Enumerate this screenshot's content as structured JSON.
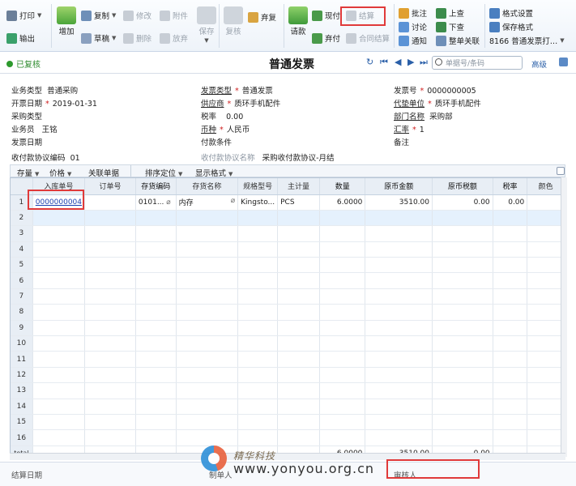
{
  "toolbar": {
    "print": "打印",
    "export": "输出",
    "add": "增加",
    "copy": "复制",
    "modify": "修改",
    "attach": "附件",
    "draft": "草稿",
    "delete": "删除",
    "abandon": "放弃",
    "save": "保存",
    "verify": "复核",
    "reprice": "弃复",
    "request_pay": "请款",
    "cash_pay": "现付",
    "settle": "结算",
    "pay": "弃付",
    "contract_settle": "合同结算",
    "annotate": "批注",
    "discuss": "讨论",
    "notify": "通知",
    "prev_page": "上查",
    "next_page": "下查",
    "full_link": "整单关联",
    "format_settings": "格式设置",
    "save_format": "保存格式",
    "template_select": "8166 普通发票打…"
  },
  "titlebar": {
    "status": "已复核",
    "title": "普通发票",
    "search_placeholder": "单据号/条码",
    "advanced": "高级"
  },
  "form": {
    "biz_type_label": "业务类型",
    "biz_type": "普通采购",
    "inv_type_label": "发票类型",
    "inv_type": "普通发票",
    "inv_no_label": "发票号",
    "inv_no": "0000000005",
    "bill_date_label": "开票日期",
    "bill_date": "2019-01-31",
    "supplier_label": "供应商",
    "supplier": "质环手机配件",
    "payee_label": "代垫单位",
    "payee": "质环手机配件",
    "purch_type_label": "采购类型",
    "purch_type": "",
    "tax_rate_label": "税率",
    "tax_rate": "0.00",
    "dept_label": "部门名称",
    "dept": "采购部",
    "staff_label": "业务员",
    "staff": "王铭",
    "currency_label": "币种",
    "currency": "人民币",
    "exch_label": "汇率",
    "exch": "1",
    "inv_date_label": "发票日期",
    "inv_date": "",
    "pay_terms_label": "付款条件",
    "pay_terms": "",
    "remark_label": "备注",
    "remark": "",
    "agree_code_label": "收付款协议编码",
    "agree_code": "01",
    "agree_name_label": "收付款协议名称",
    "agree_name": "采购收付款协议-月结"
  },
  "gridbar": {
    "stock": "存量",
    "price": "价格",
    "link": "关联单据",
    "sort": "排序定位",
    "display": "显示格式"
  },
  "grid": {
    "headers": [
      "入库单号",
      "订单号",
      "存货编码",
      "存货名称",
      "规格型号",
      "主计量",
      "数量",
      "原币金额",
      "原币税额",
      "税率",
      "颜色"
    ],
    "row1": {
      "no": "1",
      "entry": "0000000004",
      "order": "",
      "code": "0101...",
      "name": "内存",
      "spec": "Kingsto...",
      "unit": "PCS",
      "qty": "6.0000",
      "amount": "3510.00",
      "tax": "0.00",
      "rate": "0.00",
      "color": ""
    },
    "row_numbers": [
      "2",
      "3",
      "4",
      "5",
      "6",
      "7",
      "8",
      "9",
      "10",
      "11",
      "12",
      "13",
      "14",
      "15",
      "16"
    ],
    "total_label": "total",
    "total_qty": "6.0000",
    "total_amount": "3510.00",
    "total_tax": "0.00"
  },
  "footer": {
    "settle_date_label": "结算日期",
    "maker_label": "制单人",
    "auditor_label": "审核人"
  },
  "watermark": {
    "cn": "精华科技",
    "url": "www.yonyou.org.cn"
  },
  "colors": {
    "accent": "#2a5fa8",
    "highlight": "#e03a3a",
    "ok": "#2d9a2d"
  }
}
